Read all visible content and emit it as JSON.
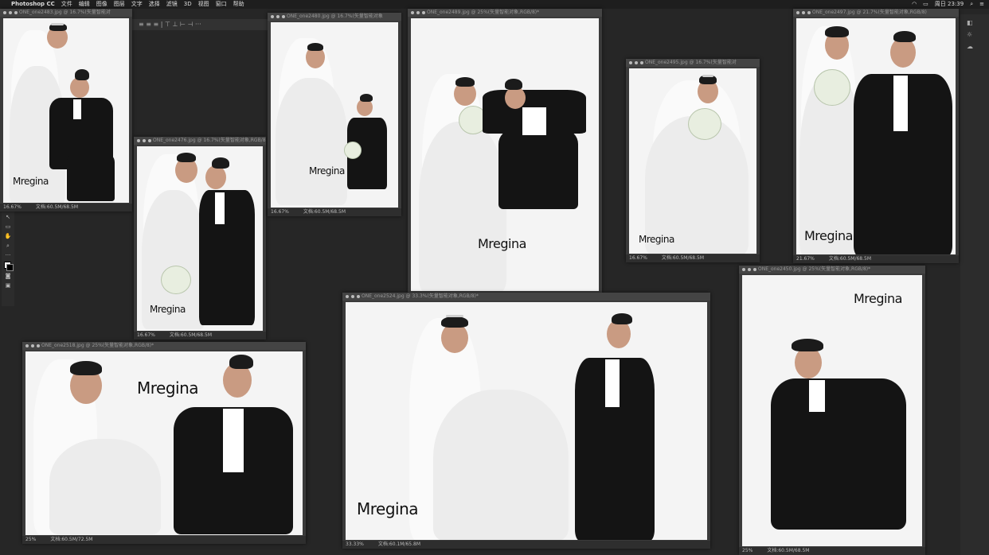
{
  "menubar": {
    "app_name": "Photoshop CC",
    "items": [
      "文件",
      "编辑",
      "图像",
      "图层",
      "文字",
      "选择",
      "滤镜",
      "3D",
      "视图",
      "窗口",
      "帮助"
    ],
    "clock": "周日 23:39"
  },
  "windows": [
    {
      "title": "ONE_one2483.jpg @ 16.7%(矢量智能对",
      "zoom": "16.67%",
      "doc": "文档:60.5M/68.5M",
      "logo": "Mregina"
    },
    {
      "title": "ONE_one2476.jpg @ 16.7%(矢量智能对象,RGB/8)",
      "zoom": "16.67%",
      "doc": "文档:60.5M/68.5M",
      "logo": "Mregina"
    },
    {
      "title": "ONE_one2480.jpg @ 16.7%(矢量智能对象",
      "zoom": "16.67%",
      "doc": "文档:60.5M/68.5M",
      "logo": "Mregina"
    },
    {
      "title": "ONE_one2489.jpg @ 25%(矢量智能对象,RGB/8)*",
      "zoom": "",
      "doc": "",
      "logo": "Mregina"
    },
    {
      "title": "ONE_one2495.jpg @ 16.7%(矢量智能对",
      "zoom": "16.67%",
      "doc": "文档:60.5M/68.5M",
      "logo": "Mregina"
    },
    {
      "title": "ONE_one2497.jpg @ 21.7%(矢量智能对象,RGB/8)",
      "zoom": "21.67%",
      "doc": "文档:60.5M/68.5M",
      "logo": "Mregina"
    },
    {
      "title": "ONE_one2518.jpg @ 25%(矢量智能对象,RGB/8)*",
      "zoom": "25%",
      "doc": "文档:60.5M/72.5M",
      "logo": "Mregina"
    },
    {
      "title": "ONE_one2524.jpg @ 33.3%(矢量智能对象,RGB/8)*",
      "zoom": "33.33%",
      "doc": "文档:60.1M/65.8M",
      "logo": "Mregina"
    },
    {
      "title": "ONE_one2450.jpg @ 25%(矢量智能对象,RGB/8)*",
      "zoom": "25%",
      "doc": "文档:60.5M/68.5M",
      "logo": "Mregina"
    }
  ]
}
